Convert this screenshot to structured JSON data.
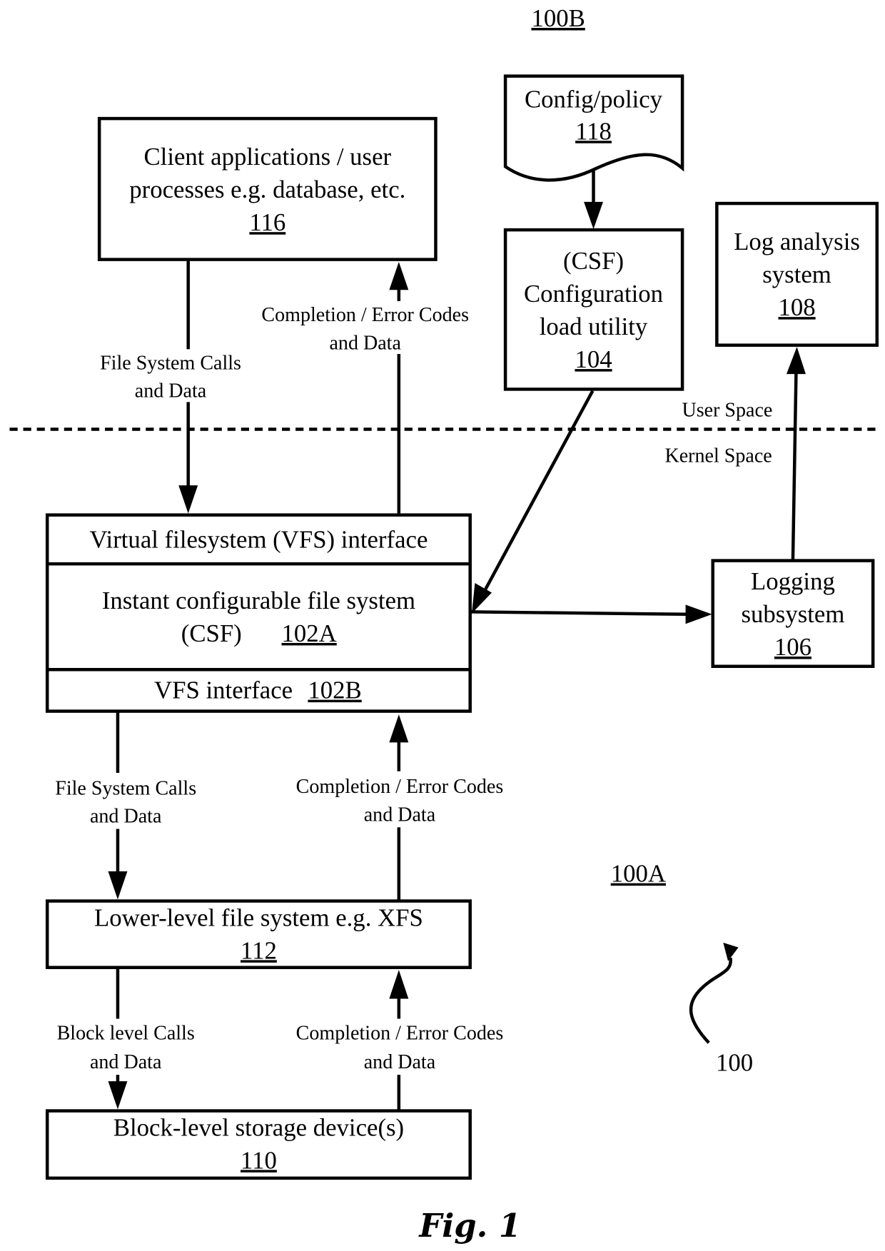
{
  "figure": {
    "title": "Fig. 1",
    "overall_ref": "100",
    "region_labels": {
      "user_region": "100B",
      "kernel_region": "100A"
    },
    "boundary": {
      "upper_label": "User Space",
      "lower_label": "Kernel Space"
    }
  },
  "nodes": {
    "client_apps": {
      "lines": [
        "Client applications / user",
        "processes e.g. database, etc."
      ],
      "ref": "116"
    },
    "config_policy": {
      "lines": [
        "Config/policy"
      ],
      "ref": "118",
      "shape": "document"
    },
    "config_load_utility": {
      "lines": [
        "(CSF)",
        "Configuration",
        "load utility"
      ],
      "ref": "104"
    },
    "log_analysis": {
      "lines": [
        "Log analysis",
        "system"
      ],
      "ref": "108"
    },
    "vfs_interface_top": {
      "lines": [
        "Virtual filesystem (VFS) interface"
      ]
    },
    "csf": {
      "lines": [
        "Instant configurable file system"
      ],
      "prefix": "(CSF)",
      "ref": "102A"
    },
    "vfs_interface_bottom": {
      "label": "VFS interface",
      "ref": "102B"
    },
    "logging_subsystem": {
      "lines": [
        "Logging",
        "subsystem"
      ],
      "ref": "106"
    },
    "lower_fs": {
      "lines": [
        "Lower-level file system e.g. XFS"
      ],
      "ref": "112"
    },
    "block_storage": {
      "lines": [
        "Block-level storage device(s)"
      ],
      "ref": "110"
    }
  },
  "edges": [
    {
      "from": "client_apps",
      "to": "vfs_interface_top",
      "label": [
        "File System Calls",
        "and Data"
      ]
    },
    {
      "from": "vfs_interface_top",
      "to": "client_apps",
      "label": [
        "Completion / Error Codes",
        "and Data"
      ]
    },
    {
      "from": "config_policy",
      "to": "config_load_utility",
      "label": []
    },
    {
      "from": "config_load_utility",
      "to": "csf",
      "label": []
    },
    {
      "from": "csf",
      "to": "logging_subsystem",
      "label": []
    },
    {
      "from": "logging_subsystem",
      "to": "log_analysis",
      "label": []
    },
    {
      "from": "vfs_interface_bottom",
      "to": "lower_fs",
      "label": [
        "File System Calls",
        "and Data"
      ]
    },
    {
      "from": "lower_fs",
      "to": "vfs_interface_bottom",
      "label": [
        "Completion / Error Codes",
        "and Data"
      ]
    },
    {
      "from": "lower_fs",
      "to": "block_storage",
      "label": [
        "Block level Calls",
        "and Data"
      ]
    },
    {
      "from": "block_storage",
      "to": "lower_fs",
      "label": [
        "Completion / Error Codes",
        "and Data"
      ]
    }
  ]
}
